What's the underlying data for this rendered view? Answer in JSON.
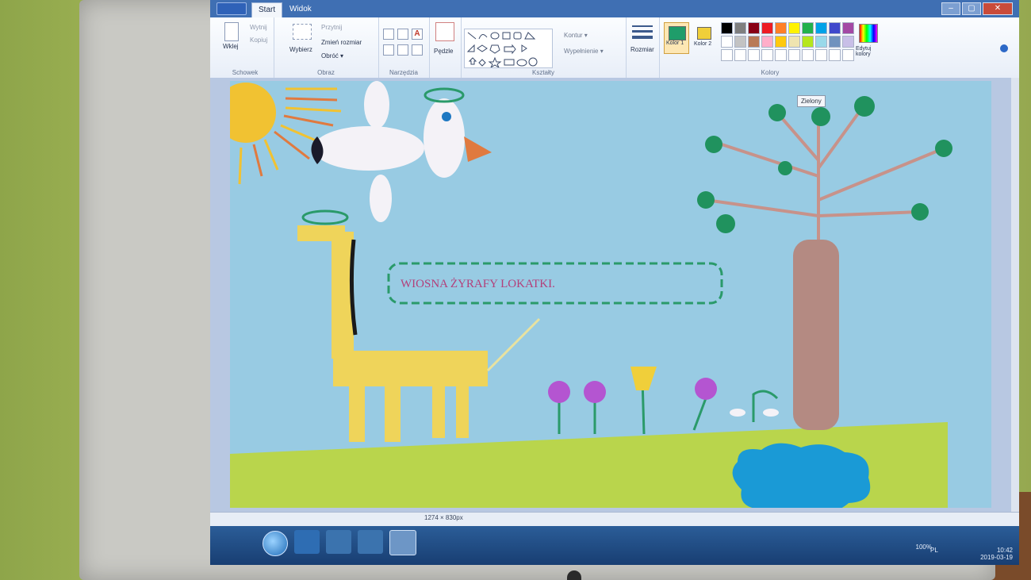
{
  "window": {
    "tabs": [
      "Start",
      "Widok"
    ]
  },
  "ribbon": {
    "clipboard": {
      "paste": "Wklej",
      "cut": "Wytnij",
      "copy": "Kopiuj",
      "label": "Schowek"
    },
    "image": {
      "select": "Wybierz",
      "crop": "Przytnij",
      "resize": "Zmień rozmiar",
      "rotate": "Obróć ▾",
      "label": "Obraz"
    },
    "tools": {
      "label": "Narzędzia"
    },
    "brushes": {
      "label": "Pędzle"
    },
    "shapes": {
      "outline": "Kontur ▾",
      "fill": "Wypełnienie ▾",
      "label": "Kształty"
    },
    "size": {
      "label": "Rozmiar"
    },
    "colors": {
      "color1": "Kolor 1",
      "color2": "Kolor 2",
      "edit": "Edytuj kolory",
      "label": "Kolory",
      "color1_value": "#1f9d6a",
      "color2_value": "#f0cf3a",
      "palette_row1": [
        "#000000",
        "#7f7f7f",
        "#880015",
        "#ed1c24",
        "#ff7f27",
        "#fff200",
        "#22b14c",
        "#00a2e8",
        "#3f48cc",
        "#a349a4"
      ],
      "palette_row2": [
        "#ffffff",
        "#c3c3c3",
        "#b97a57",
        "#ffaec9",
        "#ffc90e",
        "#efe4b0",
        "#b5e61d",
        "#99d9ea",
        "#7092be",
        "#c8bfe7"
      ]
    },
    "tooltip": "Zielony"
  },
  "canvas": {
    "banner_text": "WIOSNA ŻYRAFY LOKATKI."
  },
  "status": {
    "size": "1274 × 830px"
  },
  "taskbar": {
    "zoom": "100%",
    "lang": "PL",
    "time": "10:42",
    "date": "2019-03-19"
  }
}
